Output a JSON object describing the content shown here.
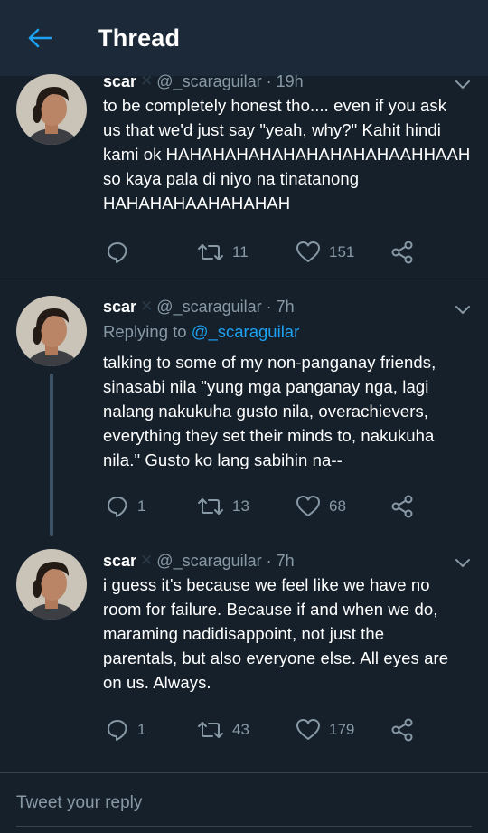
{
  "appbar": {
    "title": "Thread",
    "back_icon": "arrow-left-icon",
    "accent_color": "#1da1f2"
  },
  "tweets": [
    {
      "name": "scar",
      "handle": "@_scaraguilar",
      "time": "19h",
      "replying_to": null,
      "text": "to be completely honest tho.... even if you ask\nus that we'd just say \"yeah, why?\" Kahit hindi\nkami ok HAHAHAHAHAHAHAHAHAHAAHHAAH\nso kaya pala di niyo na tinatanong\nHAHAHAHAAHAHAHAH",
      "replies": "",
      "retweets": "11",
      "likes": "151"
    },
    {
      "name": "scar",
      "handle": "@_scaraguilar",
      "time": "7h",
      "replying_label": "Replying to",
      "replying_to": "@_scaraguilar",
      "text": "talking to some of my non-panganay friends,\nsinasabi nila \"yung mga panganay nga, lagi\nnalang nakukuha gusto nila, overachievers,\neverything they set their minds to, nakukuha\nnila.\" Gusto ko lang sabihin na--",
      "replies": "1",
      "retweets": "13",
      "likes": "68"
    },
    {
      "name": "scar",
      "handle": "@_scaraguilar",
      "time": "7h",
      "replying_to": null,
      "text": "i guess it's because we feel like we have no\nroom for failure. Because if and when we do,\nmaraming nadidisappoint, not just the\nparentals, but also everyone else. All eyes are\non us. Always.",
      "replies": "1",
      "retweets": "43",
      "likes": "179"
    }
  ],
  "composer": {
    "placeholder": "Tweet your reply"
  }
}
